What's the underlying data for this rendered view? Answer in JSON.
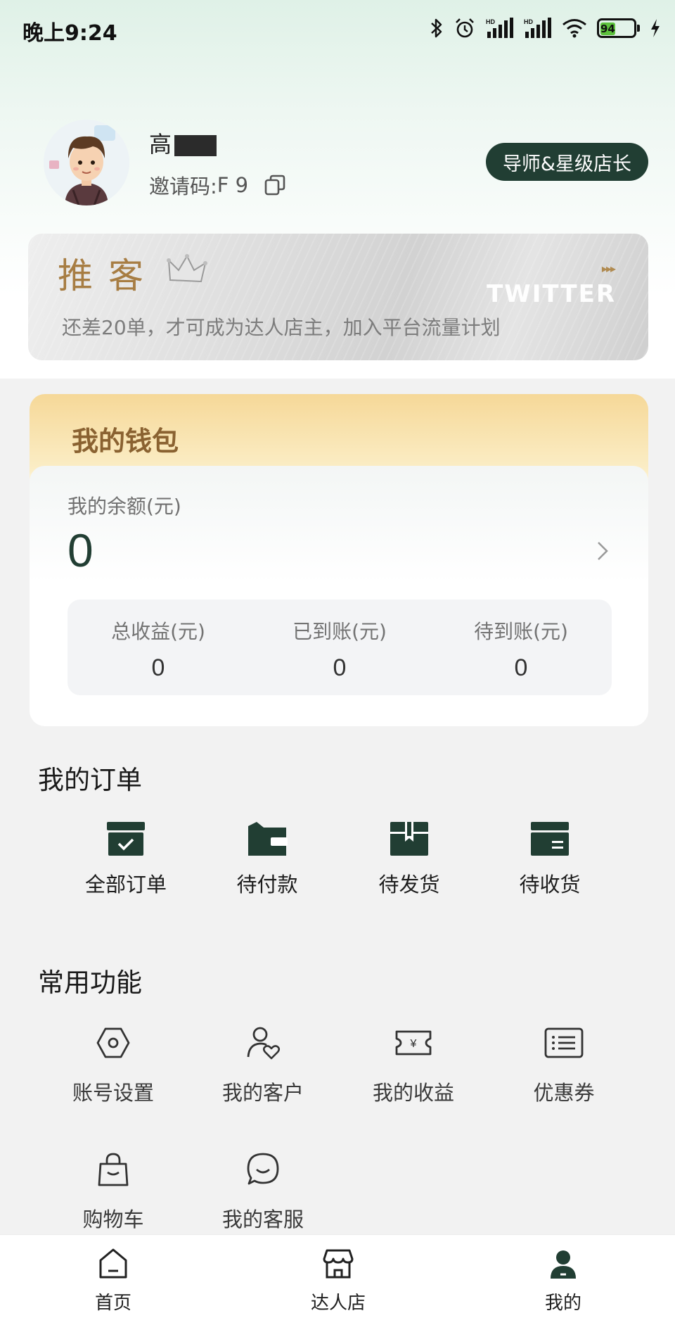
{
  "status_bar": {
    "time": "晚上9:24",
    "battery": "94",
    "hd1": "HD",
    "hd2": "HD"
  },
  "profile": {
    "name": "高",
    "invite_label": "邀请码: ",
    "invite_code": "F 9",
    "badge": "导师&星级店长"
  },
  "banner": {
    "title": "推客",
    "brand": "TWITTER",
    "arrows": "▸▸▸",
    "description": "还差20单，才可成为达人店主，加入平台流量计划"
  },
  "wallet": {
    "title": "我的钱包",
    "balance_label": "我的余额(元)",
    "balance_value": "0",
    "stats": [
      {
        "label": "总收益(元)",
        "value": "0"
      },
      {
        "label": "已到账(元)",
        "value": "0"
      },
      {
        "label": "待到账(元)",
        "value": "0"
      }
    ]
  },
  "orders": {
    "title": "我的订单",
    "items": [
      {
        "label": "全部订单",
        "icon": "box-check-icon"
      },
      {
        "label": "待付款",
        "icon": "wallet-icon"
      },
      {
        "label": "待发货",
        "icon": "package-icon"
      },
      {
        "label": "待收货",
        "icon": "delivery-box-icon"
      }
    ]
  },
  "functions": {
    "title": "常用功能",
    "items": [
      {
        "label": "账号设置",
        "icon": "settings-hex-icon"
      },
      {
        "label": "我的客户",
        "icon": "user-heart-icon"
      },
      {
        "label": "我的收益",
        "icon": "yen-ticket-icon"
      },
      {
        "label": "优惠券",
        "icon": "coupon-list-icon"
      },
      {
        "label": "购物车",
        "icon": "shopping-bag-icon"
      },
      {
        "label": "我的客服",
        "icon": "chat-smile-icon"
      }
    ]
  },
  "bottom_nav": {
    "items": [
      {
        "label": "首页",
        "icon": "home-icon"
      },
      {
        "label": "达人店",
        "icon": "store-icon"
      },
      {
        "label": "我的",
        "icon": "user-icon"
      }
    ]
  },
  "colors": {
    "brand_dark_green": "#213e33",
    "wallet_gold": "#8a6231",
    "banner_gold": "#a77d43",
    "battery_green": "#5dc23d"
  }
}
